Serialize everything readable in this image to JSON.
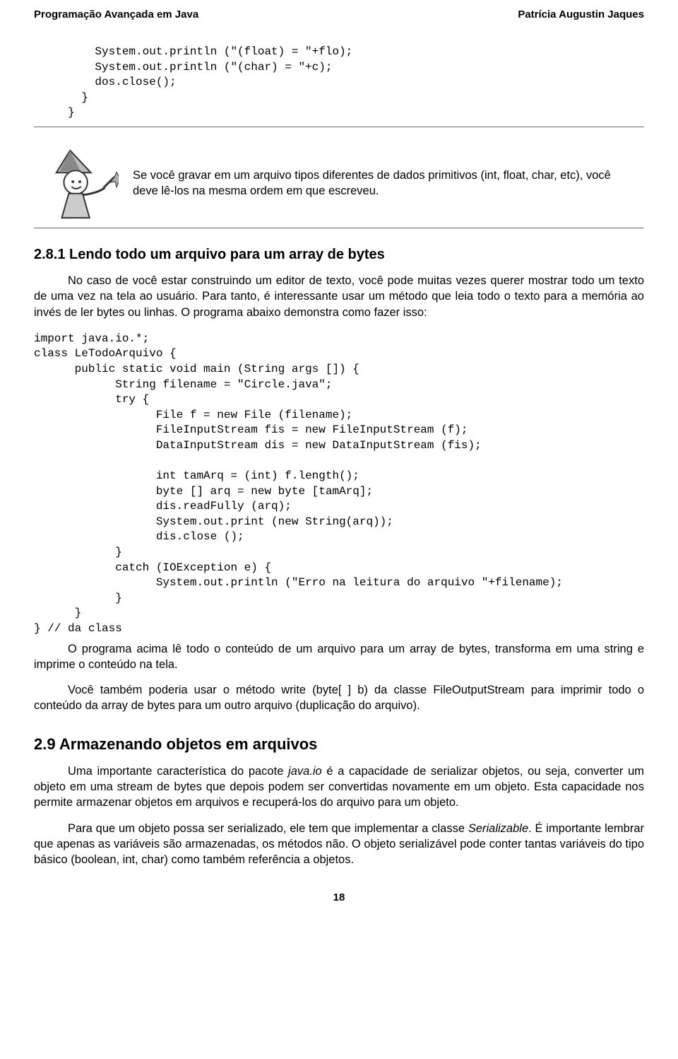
{
  "header": {
    "left": "Programação Avançada em Java",
    "right": "Patrícia Augustin Jaques"
  },
  "code_top": "    System.out.println (\"(float) = \"+flo);\n    System.out.println (\"(char) = \"+c);\n    dos.close();\n  }\n}",
  "callout": {
    "text": "Se você gravar em um arquivo tipos diferentes de dados primitivos (int, float, char, etc), você deve lê-los na mesma ordem em que escreveu."
  },
  "section281": {
    "title": "2.8.1    Lendo todo um arquivo para um array de bytes",
    "p1": "No caso de você estar construindo um editor de texto, você pode muitas vezes querer mostrar todo um texto de uma vez na tela ao usuário. Para tanto, é interessante usar um método que leia todo o texto para a memória ao invés de ler bytes ou linhas. O programa abaixo demonstra como fazer isso:"
  },
  "code_mid": "import java.io.*;\nclass LeTodoArquivo {\n      public static void main (String args []) {\n            String filename = \"Circle.java\";\n            try {\n                  File f = new File (filename);\n                  FileInputStream fis = new FileInputStream (f);\n                  DataInputStream dis = new DataInputStream (fis);\n\n                  int tamArq = (int) f.length();\n                  byte [] arq = new byte [tamArq];\n                  dis.readFully (arq);\n                  System.out.print (new String(arq));\n                  dis.close ();\n            }\n            catch (IOException e) {\n                  System.out.println (\"Erro na leitura do arquivo \"+filename);\n            }\n      }\n} // da class",
  "after_code": {
    "p1": "O programa acima lê todo o conteúdo de um arquivo para um array de bytes, transforma em uma string e imprime o conteúdo na tela.",
    "p2": "Você também poderia usar o método write (byte[ ] b) da classe FileOutputStream para imprimir todo o conteúdo da array de bytes para um outro arquivo (duplicação do arquivo)."
  },
  "section29": {
    "title": "2.9 Armazenando objetos em arquivos",
    "p1a": "Uma importante característica do pacote ",
    "p1_italic": "java.io",
    "p1b": " é a capacidade de serializar objetos, ou seja, converter um objeto em uma stream de bytes que depois podem ser convertidas novamente em um objeto. Esta capacidade nos permite armazenar objetos em arquivos e recuperá-los do arquivo para um objeto.",
    "p2a": "Para que um objeto possa ser serializado, ele tem que implementar a classe ",
    "p2_italic": "Serializable",
    "p2b": ". É importante lembrar que apenas as variáveis são armazenadas, os métodos não. O objeto serializável pode conter tantas variáveis do tipo básico (boolean, int, char) como também referência a objetos."
  },
  "page_number": "18"
}
